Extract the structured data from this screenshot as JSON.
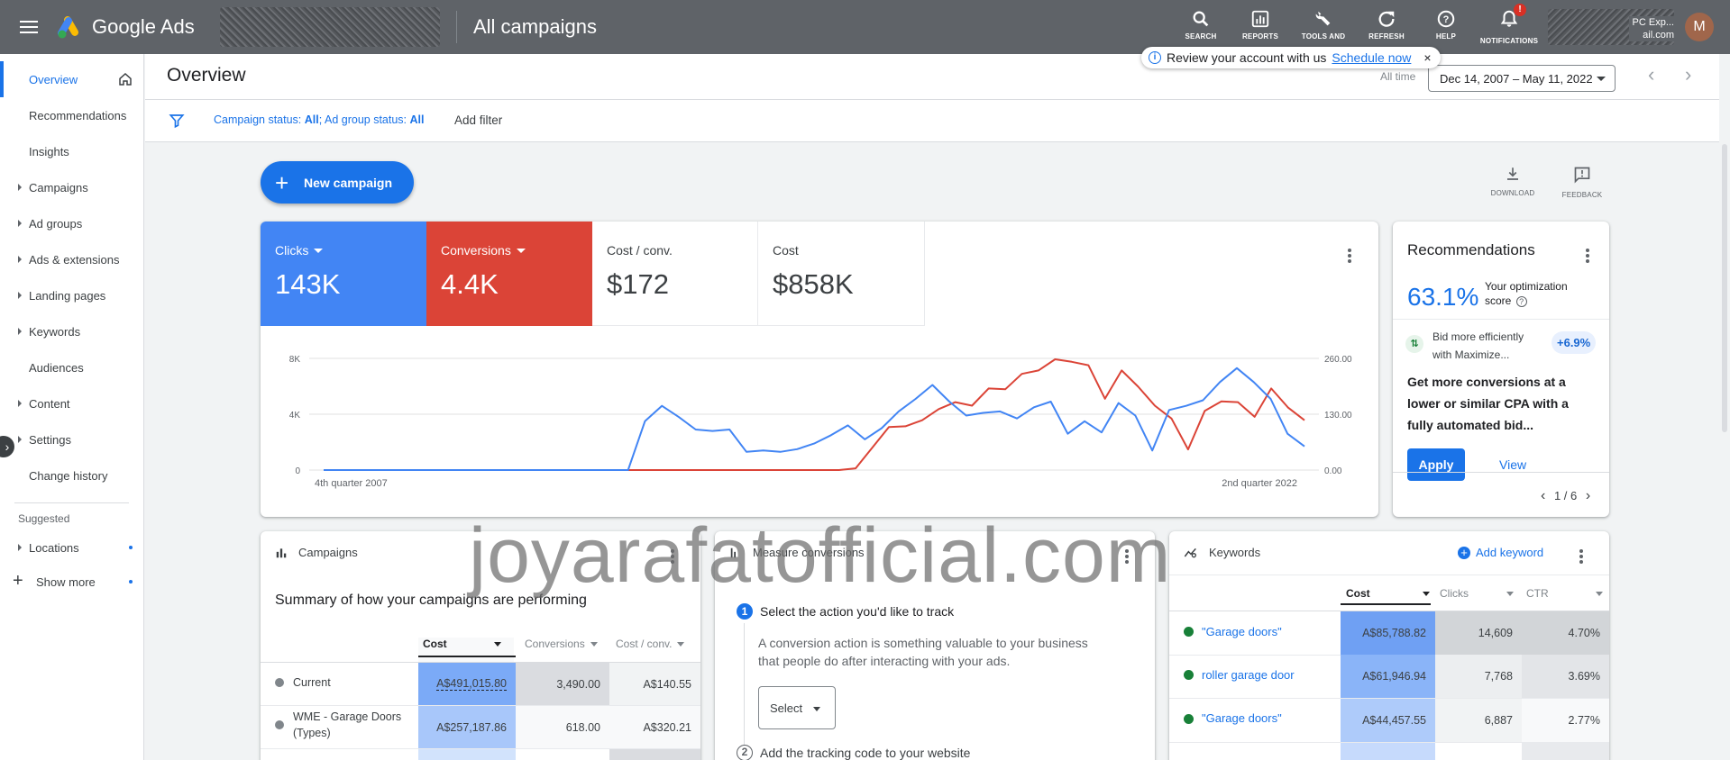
{
  "topbar": {
    "app_name": "Google Ads",
    "page_title": "All campaigns",
    "actions": [
      {
        "label": "SEARCH",
        "icon": "search-icon"
      },
      {
        "label": "REPORTS",
        "icon": "reports-icon"
      },
      {
        "label": "TOOLS AND SETTINGS",
        "icon": "wrench-icon"
      },
      {
        "label": "REFRESH",
        "icon": "refresh-icon"
      },
      {
        "label": "HELP",
        "icon": "help-icon"
      },
      {
        "label": "NOTIFICATIONS",
        "icon": "bell-icon"
      }
    ],
    "notification_badge": "!",
    "account_line1": "PC Exp...",
    "account_line2": "ail.com",
    "avatar_letter": "M"
  },
  "review": {
    "text": "Review your account with us",
    "link": "Schedule now",
    "close": "×"
  },
  "sidebar": {
    "items": [
      {
        "label": "Overview",
        "active": true,
        "caret": false
      },
      {
        "label": "Recommendations",
        "caret": false
      },
      {
        "label": "Insights",
        "caret": false
      },
      {
        "label": "Campaigns",
        "caret": true
      },
      {
        "label": "Ad groups",
        "caret": true
      },
      {
        "label": "Ads & extensions",
        "caret": true
      },
      {
        "label": "Landing pages",
        "caret": true
      },
      {
        "label": "Keywords",
        "caret": true
      },
      {
        "label": "Audiences",
        "caret": false
      },
      {
        "label": "Content",
        "caret": true
      },
      {
        "label": "Settings",
        "caret": true
      },
      {
        "label": "Change history",
        "caret": false
      }
    ],
    "suggested_label": "Suggested",
    "suggested_items": [
      {
        "label": "Locations"
      }
    ],
    "show_more": "Show more"
  },
  "header": {
    "title": "Overview",
    "all_time": "All time",
    "date_range": "Dec 14, 2007 – May 11, 2022"
  },
  "filters": {
    "campaign_status_label": "Campaign status: ",
    "campaign_status_value": "All",
    "ad_group_status_label": "; Ad group status: ",
    "ad_group_status_value": "All",
    "add_filter": "Add filter"
  },
  "toolbar": {
    "new_campaign": "New campaign",
    "download": "DOWNLOAD",
    "feedback": "FEEDBACK"
  },
  "metrics": [
    {
      "label": "Clicks",
      "value": "143K",
      "color": "#4285f4"
    },
    {
      "label": "Conversions",
      "value": "4.4K",
      "color": "#db4437"
    },
    {
      "label": "Cost / conv.",
      "value": "$172"
    },
    {
      "label": "Cost",
      "value": "$858K"
    }
  ],
  "chart_data": {
    "type": "line",
    "x_start_label": "4th quarter 2007",
    "x_end_label": "2nd quarter 2022",
    "left_axis": {
      "ticks": [
        "0",
        "4K",
        "8K"
      ],
      "range": [
        0,
        8000
      ]
    },
    "right_axis": {
      "ticks": [
        "0.00",
        "130.00",
        "260.00"
      ],
      "range": [
        0,
        260
      ]
    },
    "series": [
      {
        "name": "Clicks",
        "color": "#4285f4",
        "axis": "left",
        "values": [
          0,
          0,
          0,
          0,
          0,
          0,
          0,
          0,
          0,
          0,
          0,
          0,
          0,
          0,
          0,
          0,
          0,
          0,
          0,
          3500,
          4600,
          3800,
          2900,
          2800,
          2900,
          1300,
          1400,
          1300,
          1500,
          1900,
          2500,
          3200,
          2200,
          3000,
          4200,
          5100,
          6100,
          4900,
          3900,
          4100,
          4200,
          3700,
          4500,
          4900,
          2600,
          3500,
          2700,
          4800,
          3900,
          1400,
          4300,
          4600,
          5000,
          6300,
          7300,
          6300,
          5100,
          2600,
          1700
        ]
      },
      {
        "name": "Conversions",
        "color": "#db4437",
        "axis": "right",
        "values": [
          0,
          0,
          0,
          0,
          0,
          0,
          0,
          0,
          0,
          0,
          0,
          0,
          0,
          0,
          0,
          0,
          0,
          0,
          0,
          0,
          0,
          0,
          0,
          0,
          0,
          0,
          0,
          0,
          0,
          0,
          0,
          0,
          4,
          52,
          100,
          102,
          116,
          142,
          158,
          150,
          190,
          188,
          224,
          232,
          258,
          252,
          244,
          166,
          232,
          194,
          150,
          120,
          48,
          138,
          160,
          158,
          124,
          190,
          146,
          116
        ]
      }
    ]
  },
  "recommendations": {
    "title": "Recommendations",
    "score": "63.1%",
    "score_label": "Your optimization score",
    "item_line1": "Bid more efficiently",
    "item_line2": "with Maximize...",
    "item_pct": "+6.9%",
    "description": "Get more conversions at a lower or similar CPA with a fully automated bid...",
    "apply": "Apply",
    "view": "View",
    "page": "1 / 6"
  },
  "campaigns_card": {
    "title": "Campaigns",
    "summary": "Summary of how your campaigns are performing",
    "columns": [
      "Cost",
      "Conversions",
      "Cost / conv."
    ],
    "rows": [
      {
        "name": "Current",
        "cost": "A$491,015.80",
        "conv": "3,490.00",
        "cpc": "A$140.55"
      },
      {
        "name": "WME - Garage Doors (Types)",
        "cost": "A$257,187.86",
        "conv": "618.00",
        "cpc": "A$320.21"
      }
    ]
  },
  "conversions_card": {
    "title": "Measure conversions",
    "step1_num": "1",
    "step1_title": "Select the action you'd like to track",
    "step1_desc": "A conversion action is something valuable to your business that people do after interacting with your ads.",
    "select": "Select",
    "step2_num": "2",
    "step2_title": "Add the tracking code to your website"
  },
  "keywords_card": {
    "title": "Keywords",
    "add_keyword": "Add keyword",
    "columns": [
      "Cost",
      "Clicks",
      "CTR"
    ],
    "rows": [
      {
        "keyword": "\"Garage doors\"",
        "cost": "A$85,788.82",
        "clicks": "14,609",
        "ctr": "4.70%"
      },
      {
        "keyword": "roller garage door",
        "cost": "A$61,946.94",
        "clicks": "7,768",
        "ctr": "3.69%"
      },
      {
        "keyword": "\"Garage doors\"",
        "cost": "A$44,457.55",
        "clicks": "6,887",
        "ctr": "2.77%"
      }
    ]
  },
  "watermark": "joyarafatofficial.com"
}
